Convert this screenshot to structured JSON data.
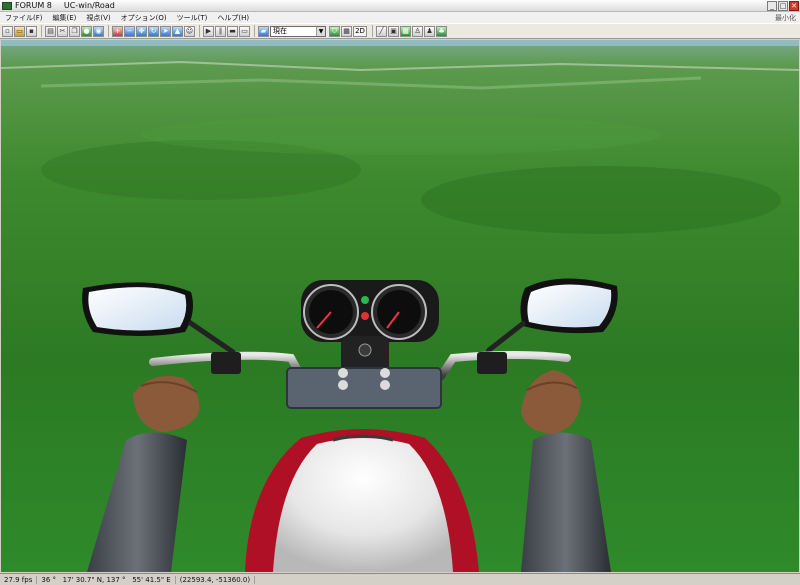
{
  "window": {
    "company": "FORUM 8",
    "app_title": "UC-win/Road",
    "min_label": "最小化",
    "buttons": {
      "minimize": "_",
      "maximize": "□",
      "close": "✕"
    }
  },
  "menu": {
    "items": [
      "ファイル(F)",
      "編集(E)",
      "視点(V)",
      "オプション(O)",
      "ツール(T)",
      "ヘルプ(H)"
    ]
  },
  "toolbar": {
    "view_mode_value": "現在",
    "two_d_label": "2D"
  },
  "status": {
    "fps": "27.9 fps",
    "latitude": "36 °   17' 30.7\" N, 137 °   55' 41.5\" E",
    "coords": "(22593.4, -51360.0)"
  },
  "colors": {
    "grass": "#3e8e2e",
    "sky_band": "#8bbfe0",
    "tank_red": "#c8102e"
  },
  "icons": [
    "new-icon",
    "open-icon",
    "save-icon",
    "print-icon",
    "cut-icon",
    "copy-icon",
    "globe-icon",
    "camera-icon",
    "zoom-in-icon",
    "zoom-out-icon",
    "pan-icon",
    "rotate-icon",
    "walk-icon",
    "fly-icon",
    "play-icon",
    "pause-icon",
    "car-icon",
    "bus-icon",
    "shield-icon",
    "map-icon",
    "terrain-icon",
    "person-icon",
    "road-icon",
    "tree-icon"
  ]
}
